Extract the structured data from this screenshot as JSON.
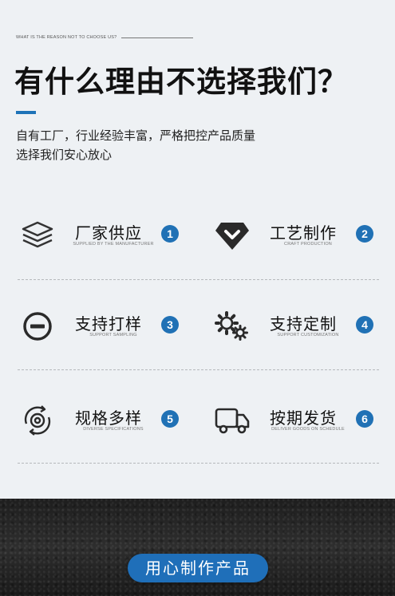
{
  "header": {
    "kicker": "WHAT IS THE REASON NOT TO CHOOSE US?",
    "title": "有什么理由不选择我们？",
    "desc_line1": "自有工厂，行业经验丰富，严格把控产品质量",
    "desc_line2": "选择我们安心放心"
  },
  "features": [
    {
      "title": "厂家供应",
      "subtitle": "SUPPLIED BY THE MANUFACTURER",
      "number": "1",
      "icon": "layers-icon"
    },
    {
      "title": "工艺制作",
      "subtitle": "CRAFT PRODUCTION",
      "number": "2",
      "icon": "diamond-icon"
    },
    {
      "title": "支持打样",
      "subtitle": "SUPPORT SAMPLING",
      "number": "3",
      "icon": "minus-circle-icon"
    },
    {
      "title": "支持定制",
      "subtitle": "SUPPORT CUSTOMIZATION",
      "number": "4",
      "icon": "gears-icon"
    },
    {
      "title": "规格多样",
      "subtitle": "DIVERSE SPECIFICATIONS",
      "number": "5",
      "icon": "cycle-gear-icon"
    },
    {
      "title": "按期发货",
      "subtitle": "DELIVER GOODS ON SCHEDULE",
      "number": "6",
      "icon": "truck-icon"
    }
  ],
  "cta": {
    "label": "用心制作产品"
  },
  "colors": {
    "accent": "#1e73b8",
    "badge": "#2071b5",
    "dark_band": "#242424"
  }
}
